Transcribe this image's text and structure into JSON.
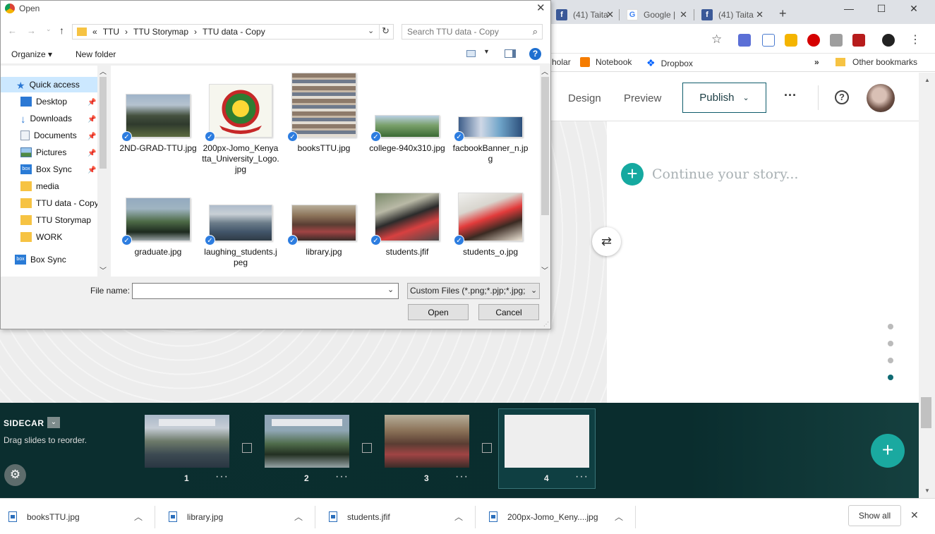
{
  "browser": {
    "tabs": [
      {
        "label": "(41) Taita",
        "icon": "facebook-icon"
      },
      {
        "label": "Google |",
        "icon": "google-icon"
      },
      {
        "label": "(41) Taita",
        "icon": "facebook-icon"
      }
    ],
    "bookmarks": [
      {
        "label": "holar"
      },
      {
        "label": "Notebook"
      },
      {
        "label": "Dropbox"
      }
    ],
    "more_bookmarks": "»",
    "other_bookmarks": "Other bookmarks"
  },
  "app": {
    "nav": {
      "design": "Design",
      "preview": "Preview",
      "publish": "Publish",
      "more": "···",
      "help": "?"
    },
    "continue_placeholder": "Continue your story...",
    "sidecar": {
      "title": "SIDECAR",
      "hint": "Drag slides to reorder.",
      "slides": [
        {
          "num": "1",
          "more": "···"
        },
        {
          "num": "2",
          "more": "···"
        },
        {
          "num": "3",
          "more": "···"
        },
        {
          "num": "4",
          "more": "···"
        }
      ]
    }
  },
  "downloads": {
    "items": [
      {
        "name": "booksTTU.jpg"
      },
      {
        "name": "library.jpg"
      },
      {
        "name": "students.jfif"
      },
      {
        "name": "200px-Jomo_Keny....jpg"
      }
    ],
    "show_all": "Show all"
  },
  "dialog": {
    "title": "Open",
    "breadcrumb": {
      "overflow": "«",
      "parts": [
        "TTU",
        "TTU Storymap",
        "TTU data - Copy"
      ],
      "sep": "›"
    },
    "search_placeholder": "Search TTU data - Copy",
    "organize": "Organize ▾",
    "new_folder": "New folder",
    "nav": [
      {
        "label": "Quick access"
      },
      {
        "label": "Desktop"
      },
      {
        "label": "Downloads"
      },
      {
        "label": "Documents"
      },
      {
        "label": "Pictures"
      },
      {
        "label": "Box Sync"
      },
      {
        "label": "media"
      },
      {
        "label": "TTU data - Copy"
      },
      {
        "label": "TTU Storymap"
      },
      {
        "label": "WORK"
      },
      {
        "label": "Box Sync"
      }
    ],
    "files": [
      {
        "name": "2ND-GRAD-TTU.jpg"
      },
      {
        "name": "200px-Jomo_Kenyatta_University_Logo.jpg"
      },
      {
        "name": "booksTTU.jpg"
      },
      {
        "name": "college-940x310.jpg"
      },
      {
        "name": "facbookBanner_n.jpg"
      },
      {
        "name": "graduate.jpg"
      },
      {
        "name": "laughing_students.jpeg"
      },
      {
        "name": "library.jpg"
      },
      {
        "name": "students.jfif"
      },
      {
        "name": "students_o.jpg"
      }
    ],
    "file_name_label": "File name:",
    "file_name_value": "",
    "filter": "Custom Files (*.png;*.pjp;*.jpg;",
    "open_button": "Open",
    "cancel_button": "Cancel"
  }
}
